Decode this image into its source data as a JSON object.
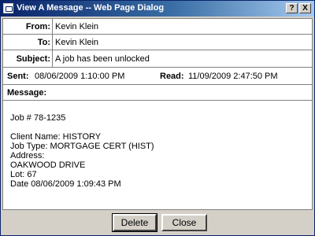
{
  "window": {
    "title": "View A Message -- Web Page Dialog",
    "help_label": "?",
    "close_label": "X"
  },
  "header": {
    "from_label": "From:",
    "from_value": "Kevin Klein",
    "to_label": "To:",
    "to_value": "Kevin Klein",
    "subject_label": "Subject:",
    "subject_value": "A job has been unlocked",
    "sent_label": "Sent:",
    "sent_value": "08/06/2009 1:10:00 PM",
    "read_label": "Read:",
    "read_value": "11/09/2009 2:47:50 PM",
    "message_label": "Message:"
  },
  "message": {
    "lines": [
      "Job # 78-1235",
      "",
      "Client Name: HISTORY",
      "Job Type: MORTGAGE CERT (HIST)",
      "Address:",
      "OAKWOOD DRIVE",
      "Lot: 67",
      "Date 08/06/2009 1:09:43 PM"
    ]
  },
  "buttons": {
    "delete_label": "Delete",
    "close_label": "Close"
  }
}
